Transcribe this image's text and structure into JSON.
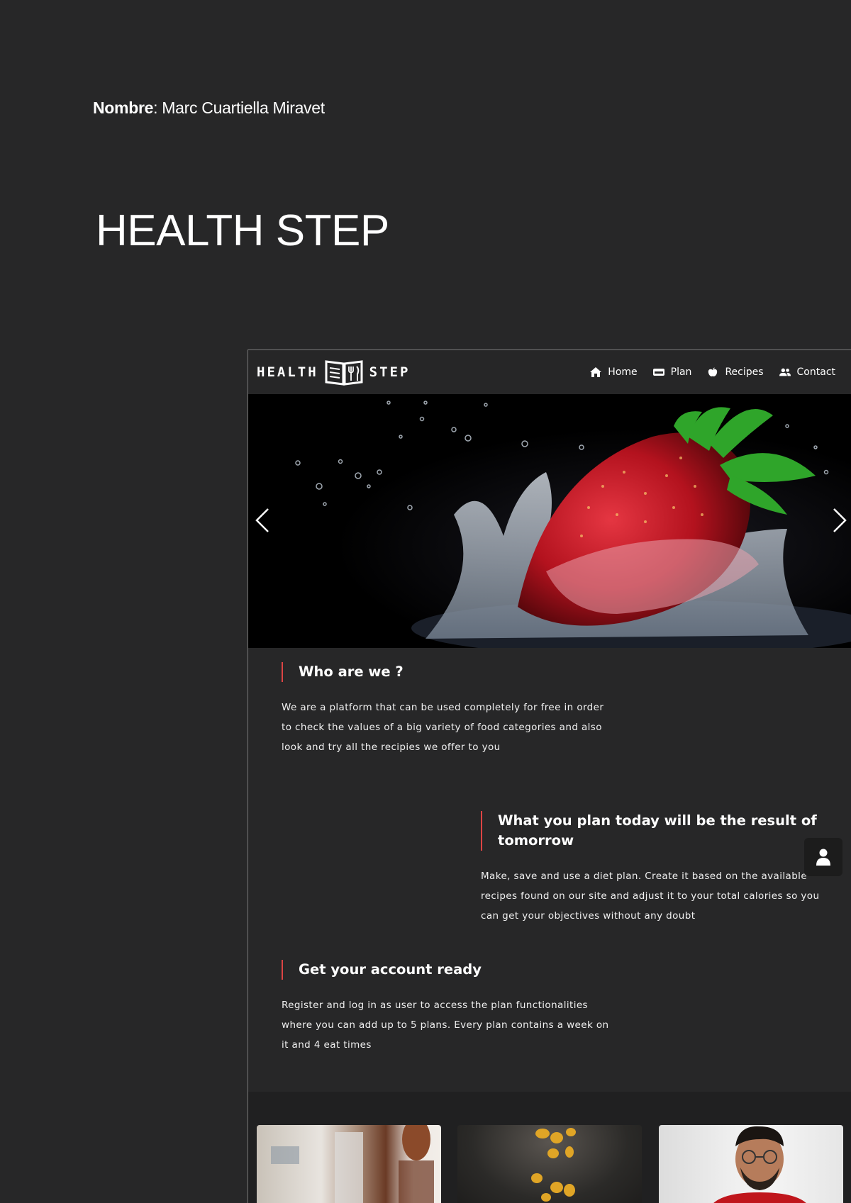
{
  "author": {
    "label": "Nombre",
    "separator": ": ",
    "name": "Marc Cuartiella Miravet"
  },
  "document_title": "HEALTH STEP",
  "site": {
    "logo": {
      "left": "HEALTH",
      "right": "STEP",
      "icon": "book-fork-knife-icon"
    },
    "nav": [
      {
        "label": "Home",
        "icon": "home-icon"
      },
      {
        "label": "Plan",
        "icon": "card-icon"
      },
      {
        "label": "Recipes",
        "icon": "apple-icon"
      },
      {
        "label": "Contact",
        "icon": "users-icon"
      }
    ],
    "hero": {
      "image": "strawberry-water-splash",
      "prev_icon": "chevron-left-icon",
      "next_icon": "chevron-right-icon"
    },
    "sections": [
      {
        "title": "Who are we ?",
        "text": "We are a platform that can be used completely for free in order to check the values of a big variety of food categories and also look and try all the recipies we offer to you"
      },
      {
        "title": "What you plan today will be the result of tomorrow",
        "text": "Make, save and use a diet plan. Create it based on the available recipes found on our site and adjust it to your total calories so you can get your objectives without any doubt"
      },
      {
        "title": "Get your account ready",
        "text": "Register and log in as user to access the plan functionalities where you can add up to 5 plans. Every plan contains a week on it and 4 eat times"
      }
    ],
    "user_button_icon": "user-icon",
    "cards": [
      {
        "image": "person-in-kitchen-photo"
      },
      {
        "image": "falling-cereal-photo"
      },
      {
        "image": "smiling-man-photo"
      }
    ],
    "accent_color": "#d44444"
  }
}
